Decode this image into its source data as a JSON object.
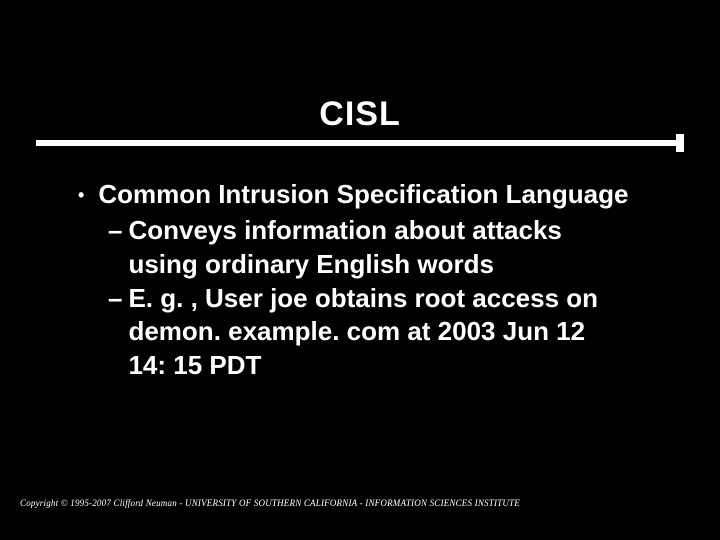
{
  "title": "CISL",
  "bullets": [
    {
      "text": "Common Intrusion Specification Language",
      "subs": [
        "Conveys information about attacks using ordinary English words",
        "E. g. , User joe obtains root access on demon. example. com at 2003 Jun 12 14: 15 PDT"
      ]
    }
  ],
  "footer": "Copyright © 1995-2007 Clifford Neuman - UNIVERSITY OF SOUTHERN CALIFORNIA - INFORMATION SCIENCES INSTITUTE"
}
